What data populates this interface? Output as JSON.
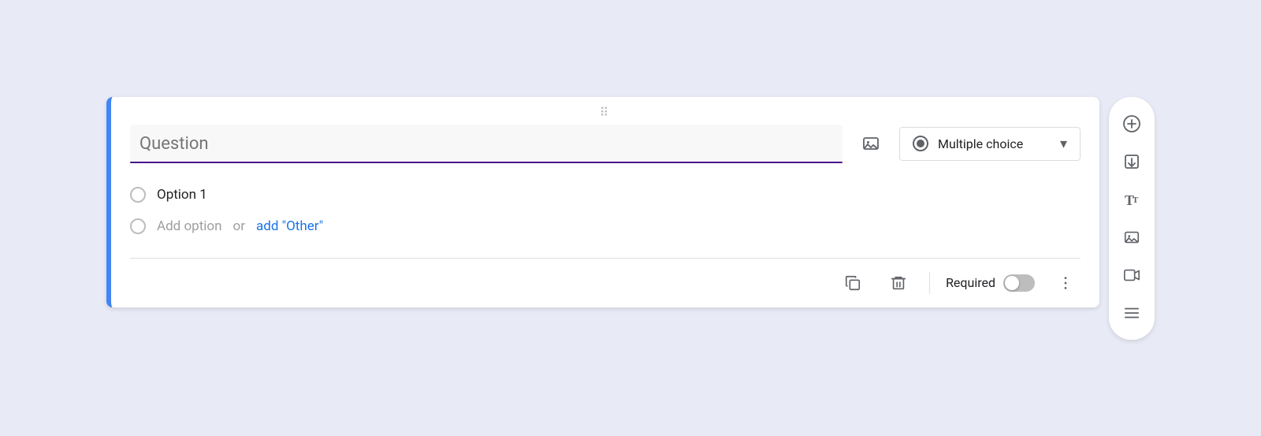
{
  "card": {
    "drag_handle_label": "drag handle",
    "question_placeholder": "Question",
    "question_image_btn_label": "Add image",
    "type_dropdown": {
      "label": "Multiple choice",
      "aria_label": "Question type dropdown"
    },
    "option1": {
      "text": "Option 1"
    },
    "add_option": {
      "text": "Add option",
      "or_text": "or",
      "add_other_label": "add \"Other\""
    },
    "bottom": {
      "copy_label": "Duplicate",
      "delete_label": "Delete",
      "required_label": "Required",
      "more_label": "More options"
    }
  },
  "sidebar": {
    "add_question_label": "Add question",
    "import_label": "Import questions",
    "title_label": "Add title and description",
    "image_label": "Add image",
    "video_label": "Add video",
    "section_label": "Add section"
  }
}
